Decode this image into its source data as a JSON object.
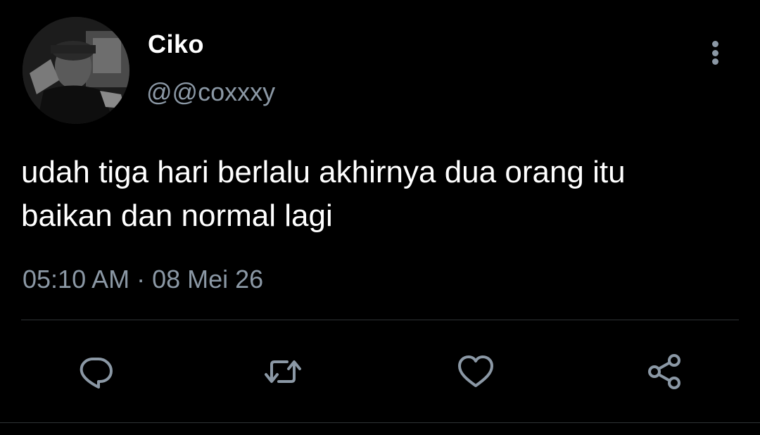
{
  "tweet": {
    "display_name": "Ciko",
    "handle": "@@coxxxy",
    "text": "udah tiga hari berlalu akhirnya dua orang itu baikan dan normal lagi",
    "timestamp": "05:10 AM · 08 Mei 26"
  },
  "actions": {
    "reply_icon": "reply-icon",
    "retweet_icon": "retweet-icon",
    "like_icon": "heart-icon",
    "share_icon": "share-icon"
  },
  "colors": {
    "background": "#000000",
    "primary_text": "#ffffff",
    "secondary_text": "#8b98a5",
    "divider": "#2f3336"
  }
}
